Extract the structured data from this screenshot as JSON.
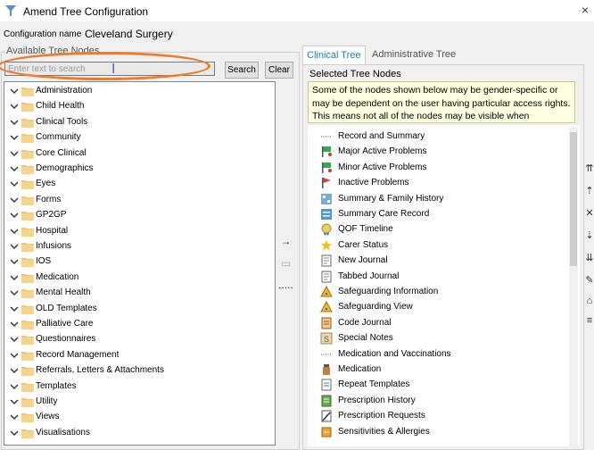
{
  "window": {
    "title": "Amend Tree Configuration",
    "close_glyph": "×"
  },
  "config": {
    "label": "Configuration name",
    "value": "Cleveland Surgery"
  },
  "available": {
    "label": "Available Tree Nodes",
    "search_placeholder": "Enter text to search",
    "search_button": "Search",
    "clear_button": "Clear",
    "items": [
      "Administration",
      "Child Health",
      "Clinical Tools",
      "Community",
      "Core Clinical",
      "Demographics",
      "Eyes",
      "Forms",
      "GP2GP",
      "Hospital",
      "Infusions",
      "IOS",
      "Medication",
      "Mental Health",
      "OLD Templates",
      "Palliative Care",
      "Questionnaires",
      "Record Management",
      "Referrals, Letters & Attachments",
      "Templates",
      "Utility",
      "Views",
      "Visualisations"
    ]
  },
  "tabs": [
    "Clinical Tree",
    "Administrative Tree"
  ],
  "selected": {
    "label": "Selected Tree Nodes",
    "info_text": "Some of the nodes shown below may be gender-specific or may be dependent on the user having particular access rights. This means not all of the nodes may be visible when",
    "items": [
      {
        "label": "Record and Summary",
        "icon": "dotted-line-icon"
      },
      {
        "label": "Major Active Problems",
        "icon": "green-flag-icon"
      },
      {
        "label": "Minor Active Problems",
        "icon": "green-flag-icon"
      },
      {
        "label": "Inactive Problems",
        "icon": "red-flag-icon"
      },
      {
        "label": "Summary & Family History",
        "icon": "family-tree-icon"
      },
      {
        "label": "Summary Care Record",
        "icon": "care-record-icon"
      },
      {
        "label": "QOF Timeline",
        "icon": "qof-icon"
      },
      {
        "label": "Carer Status",
        "icon": "star-icon"
      },
      {
        "label": "New Journal",
        "icon": "journal-icon"
      },
      {
        "label": "Tabbed Journal",
        "icon": "journal-icon"
      },
      {
        "label": "Safeguarding Information",
        "icon": "safeguarding-icon"
      },
      {
        "label": "Safeguarding View",
        "icon": "safeguarding-icon"
      },
      {
        "label": "Code Journal",
        "icon": "code-journal-icon"
      },
      {
        "label": "Special Notes",
        "icon": "special-notes-icon"
      },
      {
        "label": "Medication and Vaccinations",
        "icon": "dotted-line-icon"
      },
      {
        "label": "Medication",
        "icon": "medication-bottle-icon"
      },
      {
        "label": "Repeat Templates",
        "icon": "repeat-icon"
      },
      {
        "label": "Prescription History",
        "icon": "prescription-icon"
      },
      {
        "label": "Prescription Requests",
        "icon": "prescription-request-icon"
      },
      {
        "label": "Sensitivities & Allergies",
        "icon": "allergy-icon"
      }
    ]
  },
  "middle_buttons": [
    "→",
    "▭",
    "....."
  ],
  "side_buttons": [
    "⇈",
    "⇡",
    "✕",
    "⇣",
    "⇊",
    "✎",
    "⌂",
    "≡"
  ],
  "colors": {
    "accent": "#1f7bbf",
    "highlight": "#f07b2c",
    "info_bg": "#ffffe1"
  }
}
